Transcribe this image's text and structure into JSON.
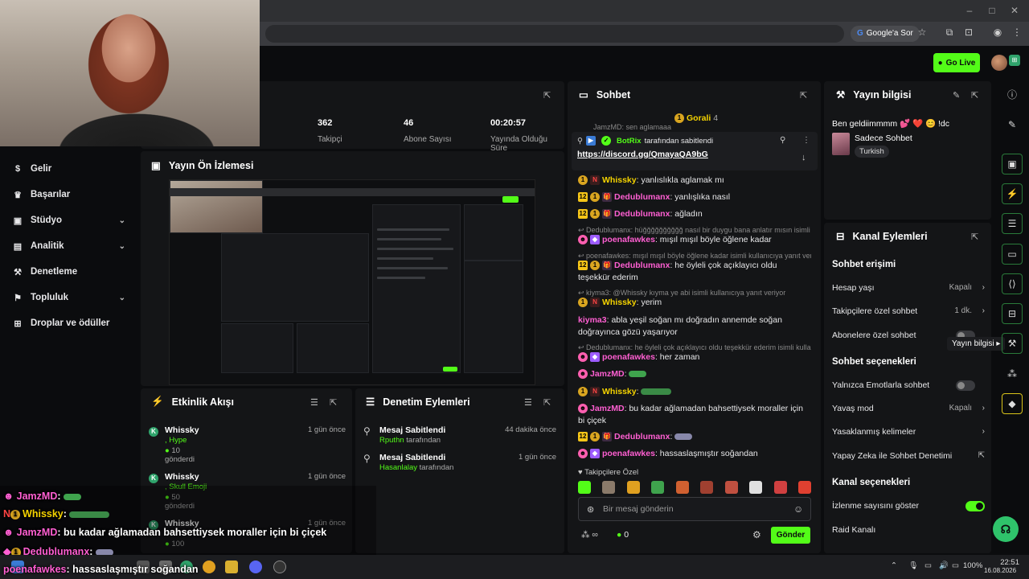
{
  "browser": {
    "search_pill": "Google'a Sor",
    "win_minimize": "–",
    "win_maximize": "□",
    "win_close": "✕"
  },
  "topbar": {
    "go_live": "Go Live"
  },
  "stats": {
    "followers_value": "362",
    "followers_label": "Takipçi",
    "subs_value": "46",
    "subs_label": "Abone Sayısı",
    "uptime_value": "00:20:57",
    "uptime_label": "Yayında Olduğu Süre"
  },
  "sidebar": {
    "items": [
      {
        "label": "Gelir",
        "icon": "$"
      },
      {
        "label": "Başarılar",
        "icon": "🏆"
      },
      {
        "label": "Stüdyo",
        "icon": "▣"
      },
      {
        "label": "Analitik",
        "icon": "▤"
      },
      {
        "label": "Denetleme",
        "icon": "⚒"
      },
      {
        "label": "Topluluk",
        "icon": "⚑"
      },
      {
        "label": "Droplar ve ödüller",
        "icon": "⊞"
      }
    ]
  },
  "preview": {
    "title": "Yayın Ön İzlemesi"
  },
  "activity": {
    "title": "Etkinlik Akışı",
    "items": [
      {
        "name": "Whissky",
        "action": ", Hype",
        "amount": "10",
        "verb": "gönderdi",
        "time": "1 gün önce"
      },
      {
        "name": "Whissky",
        "action": ", Skull Emoji",
        "amount": "50",
        "verb": "gönderdi",
        "time": "1 gün önce"
      },
      {
        "name": "Whissky",
        "action": "",
        "amount": "100",
        "verb": "",
        "time": "1 gün önce"
      }
    ]
  },
  "moderation": {
    "title": "Denetim Eylemleri",
    "items": [
      {
        "action": "Mesaj Sabitlendi",
        "by": "Rputhn",
        "suffix": "tarafından",
        "time": "44 dakika önce"
      },
      {
        "action": "Mesaj Sabitlendi",
        "by": "Hasanlalay",
        "suffix": "tarafından",
        "time": "1 gün önce"
      }
    ]
  },
  "chat": {
    "title": "Sohbet",
    "top_user": "Gorali",
    "top_count": "4",
    "pinned_by": "BotRix",
    "pinned_suffix": "tarafından sabitlendi",
    "pinned_link": "https://discord.gg/QmayaQA9bG",
    "partial_line": "JamzMD: sen aglamaaa",
    "messages": [
      {
        "user": "Whissky",
        "text": ": yanlıslıkla aglamak mı"
      },
      {
        "user": "Dedublumanx",
        "text": ": yanlışlıka nasıl"
      },
      {
        "user": "Dedublumanx",
        "text": ": ağladın"
      },
      {
        "reply": "Dedublumanx: hüğğğğğğğğğğ nasıl bir duygu bana anlatır mısın isimli k...",
        "user": "poenafawkes",
        "text": ": mışıl mışıl böyle öğlene kadar"
      },
      {
        "reply": "poenafawkes: mışıl mışıl böyle öğlene kadar isimli kullanıcıya yanıt veri...",
        "user": "Dedublumanx",
        "text": ": he öyleli çok açıklayıcı oldu teşekkür ederim"
      },
      {
        "reply": "kiyma3: @Whissky kıyma ye abi isimli kullanıcıya yanıt veriyor",
        "user": "Whissky",
        "text": ": yerim"
      },
      {
        "user": "kiyma3",
        "text": ": abla yeşil soğan mı doğradın annemde soğan doğrayınca gözü yaşarıyor"
      },
      {
        "reply": "Dedublumanx: he öyleli çok açıklayıcı oldu teşekkür ederim isimli kulla...",
        "user": "poenafawkes",
        "text": ": her zaman"
      },
      {
        "user": "JamzMD",
        "text": ":"
      },
      {
        "user": "Whissky",
        "text": ":"
      },
      {
        "user": "JamzMD",
        "text": ": bu kadar ağlamadan bahsettiysek moraller için bi çiçek"
      },
      {
        "user": "Dedublumanx",
        "text": ":"
      },
      {
        "user": "poenafawkes",
        "text": ": hassaslaşmıştır soğandan"
      }
    ],
    "followers_only": "Takipçilere Özel",
    "input_placeholder": "Bir mesaj gönderin",
    "points": "0",
    "send": "Gönder"
  },
  "stream_info": {
    "title": "Yayın bilgisi",
    "stream_title": "Ben geldiimmmm 💕 ❤️ 😊 !dc",
    "category": "Sadece Sohbet",
    "tag": "Turkish"
  },
  "channel_actions": {
    "title": "Kanal Eylemleri",
    "chat_access_heading": "Sohbet erişimi",
    "account_age": "Hesap yaşı",
    "account_age_val": "Kapalı",
    "followers_chat": "Takipçilere özel sohbet",
    "followers_chat_val": "1 dk.",
    "subs_chat": "Abonelere özel sohbet",
    "chat_options_heading": "Sohbet seçenekleri",
    "emote_only": "Yalnızca Emotlarla sohbet",
    "slow_mode": "Yavaş mod",
    "slow_mode_val": "Kapalı",
    "banned_words": "Yasaklanmış kelimeler",
    "ai_moderation": "Yapay Zeka ile Sohbet Denetimi",
    "channel_options_heading": "Kanal seçenekleri",
    "show_viewers": "İzlenme sayısını göster",
    "raid": "Raid Kanalı",
    "tooltip": "Yayın bilgisi"
  },
  "overlay": {
    "lines": [
      {
        "user": "JamzMD",
        "text": ":"
      },
      {
        "user": "Whissky",
        "text": ":"
      },
      {
        "user": "JamzMD",
        "text": ": bu kadar ağlamadan bahsettiysek moraller için bi çiçek"
      },
      {
        "user": "Dedublumanx",
        "text": ":"
      },
      {
        "user": "poenafawkes",
        "text": ": hassaslaşmıştır soğandan"
      }
    ]
  },
  "taskbar": {
    "battery": "100%",
    "time": "22:51",
    "date": "16.08.2026"
  },
  "colors": {
    "accent": "#53fc18",
    "panel": "#141517",
    "bg": "#0b0c0e"
  }
}
